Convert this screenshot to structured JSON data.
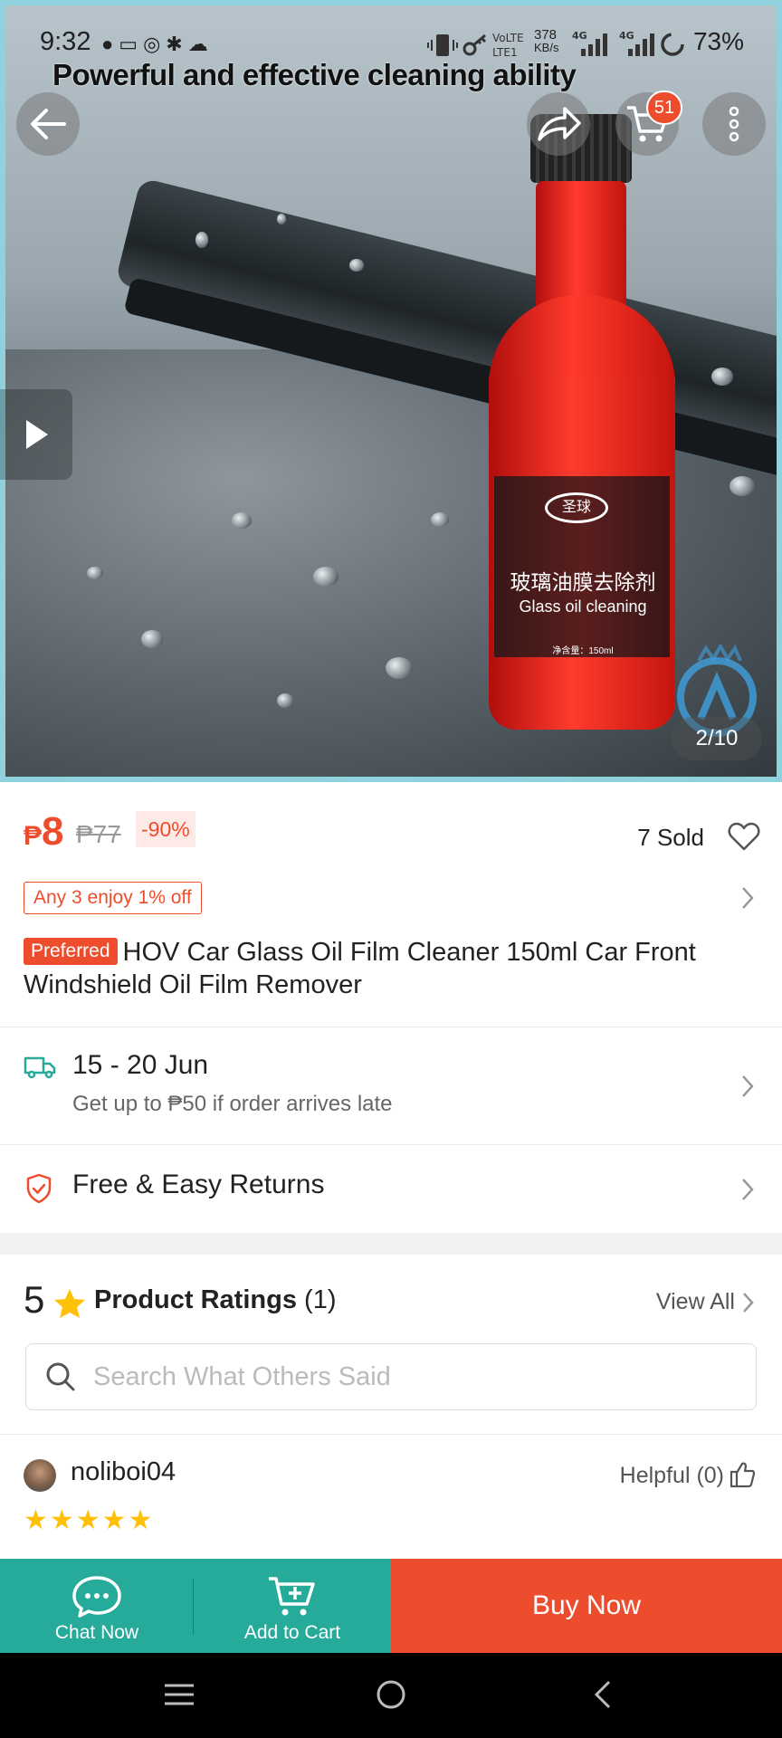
{
  "status_bar": {
    "time": "9:32",
    "net_speed": "378",
    "net_unit": "KB/s",
    "battery": "73%",
    "notification_icons": [
      "chat-bubble-icon",
      "card-icon",
      "camera-icon",
      "settings-icon",
      "cloud-icon"
    ]
  },
  "hero": {
    "caption": "Powerful and effective cleaning ability",
    "bottle_label_cn": "玻璃油膜去除剂",
    "bottle_label_en": "Glass oil cleaning",
    "bottle_brand": "圣球",
    "bottle_volume": "净含量：150ml",
    "cart_count": "51",
    "image_counter": "2/10"
  },
  "product": {
    "currency": "₱",
    "price": "8",
    "original_price": "₱77",
    "discount": "-90%",
    "sold": "7 Sold",
    "promo": "Any 3 enjoy 1% off",
    "preferred_badge": "Preferred",
    "title": "HOV Car Glass Oil Film Cleaner 150ml Car Front Windshield Oil Film Remover"
  },
  "shipping": {
    "date_range": "15 - 20 Jun",
    "guarantee": "Get up to ₱50 if order arrives late"
  },
  "returns": {
    "label": "Free & Easy Returns"
  },
  "ratings": {
    "score": "5",
    "title": "Product Ratings",
    "count": "(1)",
    "view_all": "View All",
    "search_placeholder": "Search What Others Said"
  },
  "review": {
    "username": "noliboi04",
    "helpful": "Helpful (0)",
    "stars": "★★★★★"
  },
  "actions": {
    "chat": "Chat Now",
    "add_to_cart": "Add to Cart",
    "buy_now": "Buy Now"
  },
  "colors": {
    "brand": "#ee4d2d",
    "teal": "#26aa99",
    "star": "#ffc107"
  }
}
